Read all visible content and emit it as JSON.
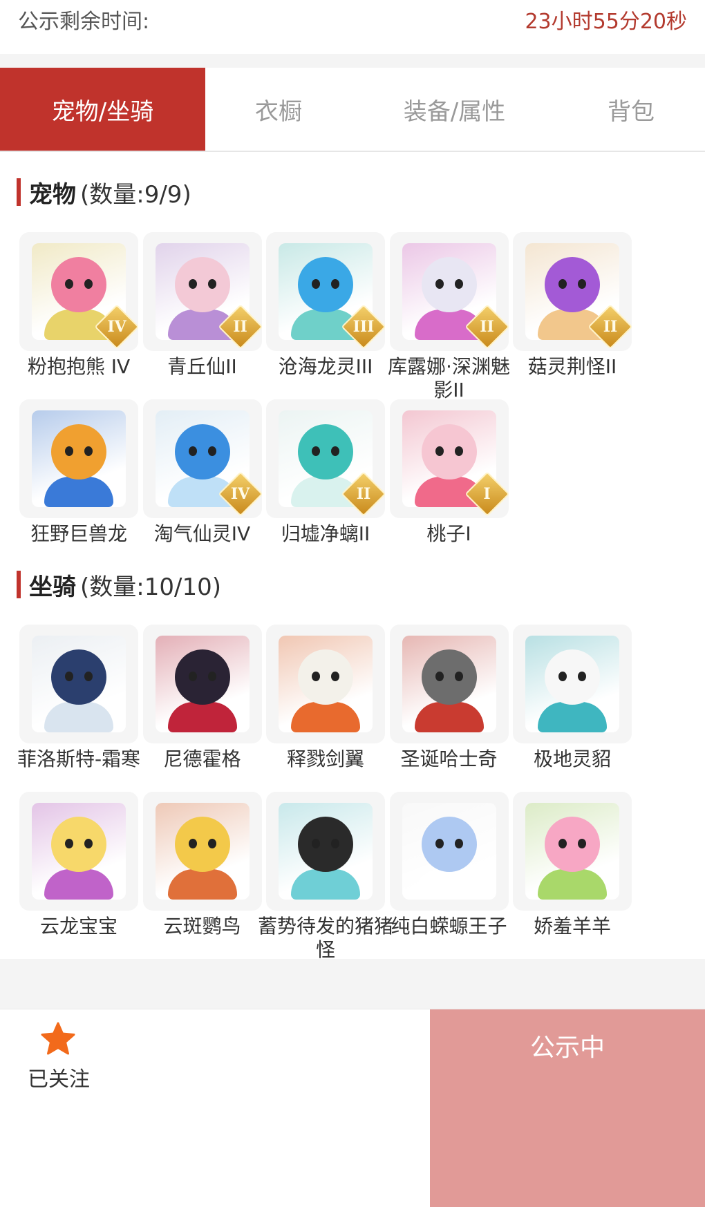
{
  "countdown": {
    "label": "公示剩余时间:",
    "value": "23小时55分20秒"
  },
  "tabs": [
    {
      "label": "宠物/坐骑",
      "active": true
    },
    {
      "label": "衣橱",
      "active": false
    },
    {
      "label": "装备/属性",
      "active": false
    },
    {
      "label": "背包",
      "active": false
    }
  ],
  "pets": {
    "title": "宠物",
    "count": "(数量:9/9)",
    "items": [
      {
        "name": "粉抱抱熊 IV",
        "badge": "IV",
        "colors": [
          "#f07fa0",
          "#e8d36a"
        ]
      },
      {
        "name": "青丘仙II",
        "badge": "II",
        "colors": [
          "#f3c9d6",
          "#b98fd6"
        ]
      },
      {
        "name": "沧海龙灵III",
        "badge": "III",
        "colors": [
          "#3aa8e6",
          "#6fd0c9"
        ]
      },
      {
        "name": "库露娜·深渊魅影II",
        "badge": "II",
        "colors": [
          "#e8e6f3",
          "#d86cc9"
        ]
      },
      {
        "name": "菇灵荆怪II",
        "badge": "II",
        "colors": [
          "#a35ad6",
          "#f2c78c"
        ]
      },
      {
        "name": "狂野巨兽龙",
        "badge": "",
        "colors": [
          "#f0a030",
          "#3a7ad8"
        ]
      },
      {
        "name": "淘气仙灵IV",
        "badge": "IV",
        "colors": [
          "#3b8fe0",
          "#bfe0f7"
        ]
      },
      {
        "name": "归墟净螭II",
        "badge": "II",
        "colors": [
          "#3ec0b8",
          "#d9f2ee"
        ]
      },
      {
        "name": "桃子I",
        "badge": "I",
        "colors": [
          "#f6c6d2",
          "#f06a8a"
        ]
      }
    ]
  },
  "mounts": {
    "title": "坐骑",
    "count": "(数量:10/10)",
    "items": [
      {
        "name": "菲洛斯特-霜寒",
        "colors": [
          "#2b3f6e",
          "#d9e4ef"
        ]
      },
      {
        "name": "尼德霍格",
        "colors": [
          "#2a2334",
          "#c0243a"
        ]
      },
      {
        "name": "释戮剑翼",
        "colors": [
          "#f3f1ea",
          "#e86a2e"
        ]
      },
      {
        "name": "圣诞哈士奇",
        "colors": [
          "#6d6d6d",
          "#c93b30"
        ]
      },
      {
        "name": "极地灵貂",
        "colors": [
          "#f7f7f7",
          "#3fb6c0"
        ]
      },
      {
        "name": "云龙宝宝",
        "colors": [
          "#f7d86a",
          "#c063c9"
        ]
      },
      {
        "name": "云斑鹦鸟",
        "colors": [
          "#f3c94a",
          "#e0703a"
        ]
      },
      {
        "name": "蓄势待发的猪猪怪",
        "colors": [
          "#2a2a2a",
          "#6fcfd6"
        ]
      },
      {
        "name": "纯白蝾螈王子",
        "colors": [
          "#aec9f2",
          "#ffffff"
        ]
      },
      {
        "name": "娇羞羊羊",
        "colors": [
          "#f7a7c4",
          "#a9d86a"
        ]
      }
    ]
  },
  "footer": {
    "follow_label": "已关注",
    "status_label": "公示中"
  },
  "accent_color": "#c0332c"
}
